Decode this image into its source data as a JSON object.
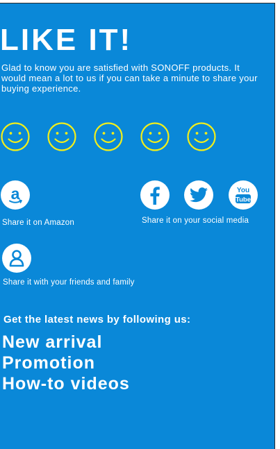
{
  "page": {
    "headline": "LIKE IT!",
    "intro": "Glad to know you are satisfied with SONOFF products. It would mean a lot to us if you can take a minute to share your buying experience.",
    "background_color": "#0a88d8",
    "rating_color": "#f2ee1a"
  },
  "rating": {
    "faces": [
      {
        "icon": "smiley-icon"
      },
      {
        "icon": "smiley-icon"
      },
      {
        "icon": "smiley-icon"
      },
      {
        "icon": "smiley-icon"
      },
      {
        "icon": "smiley-icon"
      }
    ]
  },
  "share": {
    "amazon": {
      "icon": "amazon-icon",
      "label": "Share it on Amazon"
    },
    "social": {
      "icons": [
        "facebook-icon",
        "twitter-icon",
        "youtube-icon"
      ],
      "youtube_top": "You",
      "youtube_bottom": "Tube",
      "label": "Share it on your social media"
    },
    "friends": {
      "icon": "person-icon",
      "label": "Share it with your friends and family"
    }
  },
  "follow": {
    "title": "Get the latest news by following us:",
    "items": [
      "New arrival",
      "Promotion",
      "How-to videos"
    ]
  }
}
